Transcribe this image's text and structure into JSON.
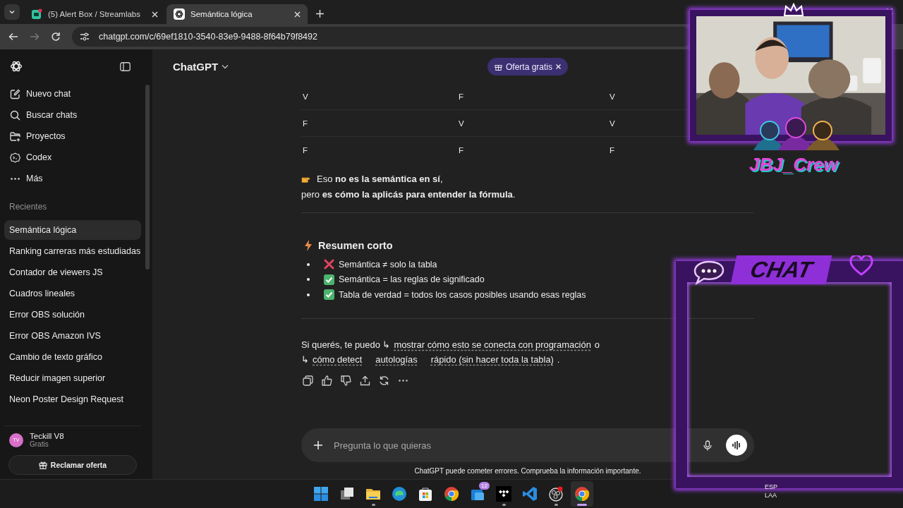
{
  "browser": {
    "tabs": [
      {
        "title": "(5) Alert Box / Streamlabs",
        "kind": "streamlabs",
        "selected": false
      },
      {
        "title": "Semántica lógica",
        "kind": "chatgpt",
        "selected": true
      }
    ],
    "url": "chatgpt.com/c/69ef1810-3540-83e9-9488-8f64b79f8492"
  },
  "sidebar": {
    "nav": [
      {
        "label": "Nuevo chat",
        "kind": "new"
      },
      {
        "label": "Buscar chats",
        "kind": "search"
      },
      {
        "label": "Proyectos",
        "kind": "projects"
      },
      {
        "label": "Codex",
        "kind": "codex"
      },
      {
        "label": "Más",
        "kind": "more"
      }
    ],
    "recents_heading": "Recientes",
    "recents": [
      {
        "label": "Semántica lógica",
        "selected": true
      },
      {
        "label": "Ranking carreras más estudiadas",
        "selected": false
      },
      {
        "label": "Contador de viewers JS",
        "selected": false
      },
      {
        "label": "Cuadros lineales",
        "selected": false
      },
      {
        "label": "Error OBS solución",
        "selected": false
      },
      {
        "label": "Error OBS Amazon IVS",
        "selected": false
      },
      {
        "label": "Cambio de texto gráfico",
        "selected": false
      },
      {
        "label": "Reducir imagen superior",
        "selected": false
      },
      {
        "label": "Neon Poster Design Request",
        "selected": false
      }
    ],
    "user": {
      "initials": "TV",
      "name": "Teckill V8",
      "plan": "Gratis"
    },
    "offer_button": "Reclamar oferta"
  },
  "header": {
    "title": "ChatGPT",
    "promo": "Oferta gratis"
  },
  "table": {
    "rows": [
      [
        "V",
        "F",
        "V"
      ],
      [
        "F",
        "V",
        "V"
      ],
      [
        "F",
        "F",
        "F"
      ]
    ]
  },
  "note_lines": [
    "Eso **no es la semántica en sí**,",
    "pero **es cómo la aplicás para entender la fórmula**."
  ],
  "summary": {
    "title": "Resumen corto",
    "items": [
      {
        "kind": "cross",
        "text": "Semántica ≠ solo la tabla"
      },
      {
        "kind": "check",
        "text": "Semántica = las reglas de significado"
      },
      {
        "kind": "check",
        "text": "Tabla de verdad = todos los casos posibles usando esas reglas"
      }
    ]
  },
  "followup": [
    {
      "kind": "text",
      "text": "Si querés, te puedo ↳"
    },
    {
      "kind": "link",
      "text": "mostrar cómo esto se conecta con programación"
    },
    {
      "kind": "text",
      "text": "o ↳"
    },
    {
      "kind": "link",
      "text": "cómo detect"
    },
    {
      "kind": "link",
      "text": "autologías"
    },
    {
      "kind": "link",
      "text": "rápido (sin hacer toda la tabla)"
    },
    {
      "kind": "text",
      "text": "."
    }
  ],
  "actions": [
    {
      "kind": "copy"
    },
    {
      "kind": "like"
    },
    {
      "kind": "dislike"
    },
    {
      "kind": "share"
    },
    {
      "kind": "retry"
    },
    {
      "kind": "more"
    }
  ],
  "composer": {
    "placeholder": "Pregunta lo que quieras"
  },
  "disclaimer": "ChatGPT puede cometer errores. Comprueba la información importante.",
  "taskbar": {
    "apps": [
      {
        "kind": "start",
        "running": false,
        "selected": false
      },
      {
        "kind": "taskview",
        "running": false,
        "selected": false
      },
      {
        "kind": "explorer",
        "running": true,
        "selected": false
      },
      {
        "kind": "edge",
        "running": false,
        "selected": false
      },
      {
        "kind": "store",
        "running": false,
        "selected": false
      },
      {
        "kind": "chrome",
        "running": false,
        "selected": false
      },
      {
        "kind": "mail",
        "running": false,
        "selected": false,
        "badge": "12"
      },
      {
        "kind": "tidal",
        "running": true,
        "selected": false
      },
      {
        "kind": "vscode",
        "running": false,
        "selected": false
      },
      {
        "kind": "obs",
        "running": true,
        "selected": false
      },
      {
        "kind": "chrome",
        "running": true,
        "selected": true
      }
    ],
    "language": [
      "ESP",
      "LAA"
    ]
  },
  "overlay": {
    "logo": "JBJ_Crew",
    "chat_title": "CHAT"
  }
}
